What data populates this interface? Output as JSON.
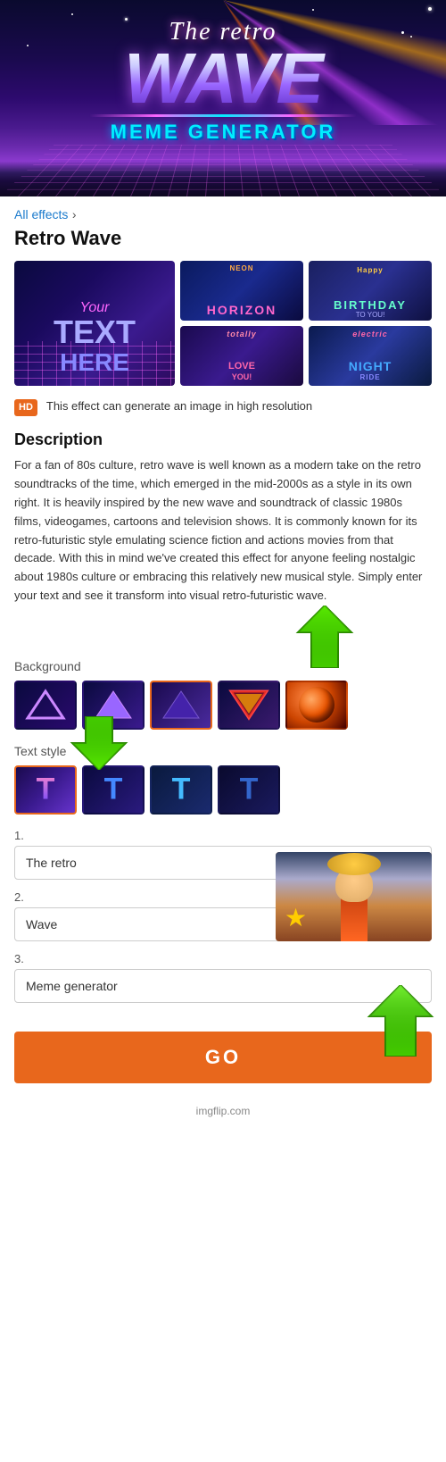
{
  "hero": {
    "the_retro": "The retro",
    "wave": "WAVE",
    "meme_generator": "MEME GENERATOR"
  },
  "breadcrumb": {
    "link_text": "All effects",
    "separator": "›",
    "current": "Retro Wave"
  },
  "page_title": "Retro Wave",
  "hd_badge": "HD",
  "hd_text": "This effect can generate an image in high resolution",
  "description_title": "Description",
  "description_body": "For a fan of 80s culture, retro wave is well known as a modern take on the retro soundtracks of the time, which emerged in the mid-2000s as a style in its own right. It is heavily inspired by the new wave and soundtrack of classic 1980s films, videogames, cartoons and television shows. It is commonly known for its retro-futuristic style emulating science fiction and actions movies from that decade. With this in mind we've created this effect for anyone feeling nostalgic about 1980s culture or embracing this relatively new musical style. Simply enter your text and see it transform into visual retro-futuristic wave.",
  "background_label": "Background",
  "text_style_label": "Text style",
  "background_options": [
    {
      "id": "bg1",
      "selected": false,
      "shape": "triangle_outline",
      "color": "#aa66ff"
    },
    {
      "id": "bg2",
      "selected": false,
      "shape": "triangle_filled",
      "color": "#9955ee"
    },
    {
      "id": "bg3",
      "selected": true,
      "shape": "triangle_dark",
      "color": "#5533aa"
    },
    {
      "id": "bg4",
      "selected": false,
      "shape": "triangle_inverted",
      "color": "#ff4444"
    },
    {
      "id": "bg5",
      "selected": false,
      "shape": "planet",
      "color": "#ff6600"
    }
  ],
  "text_style_options": [
    {
      "id": "ts1",
      "selected": true,
      "style": "pink_blue"
    },
    {
      "id": "ts2",
      "selected": false,
      "style": "blue"
    },
    {
      "id": "ts3",
      "selected": false,
      "style": "teal"
    },
    {
      "id": "ts4",
      "selected": false,
      "style": "dark_blue"
    }
  ],
  "inputs": [
    {
      "number": "1.",
      "value": "The retro",
      "placeholder": ""
    },
    {
      "number": "2.",
      "value": "Wave",
      "placeholder": ""
    },
    {
      "number": "3.",
      "value": "Meme generator",
      "placeholder": ""
    }
  ],
  "go_button": "GO",
  "footer_text": "imgflip.com"
}
